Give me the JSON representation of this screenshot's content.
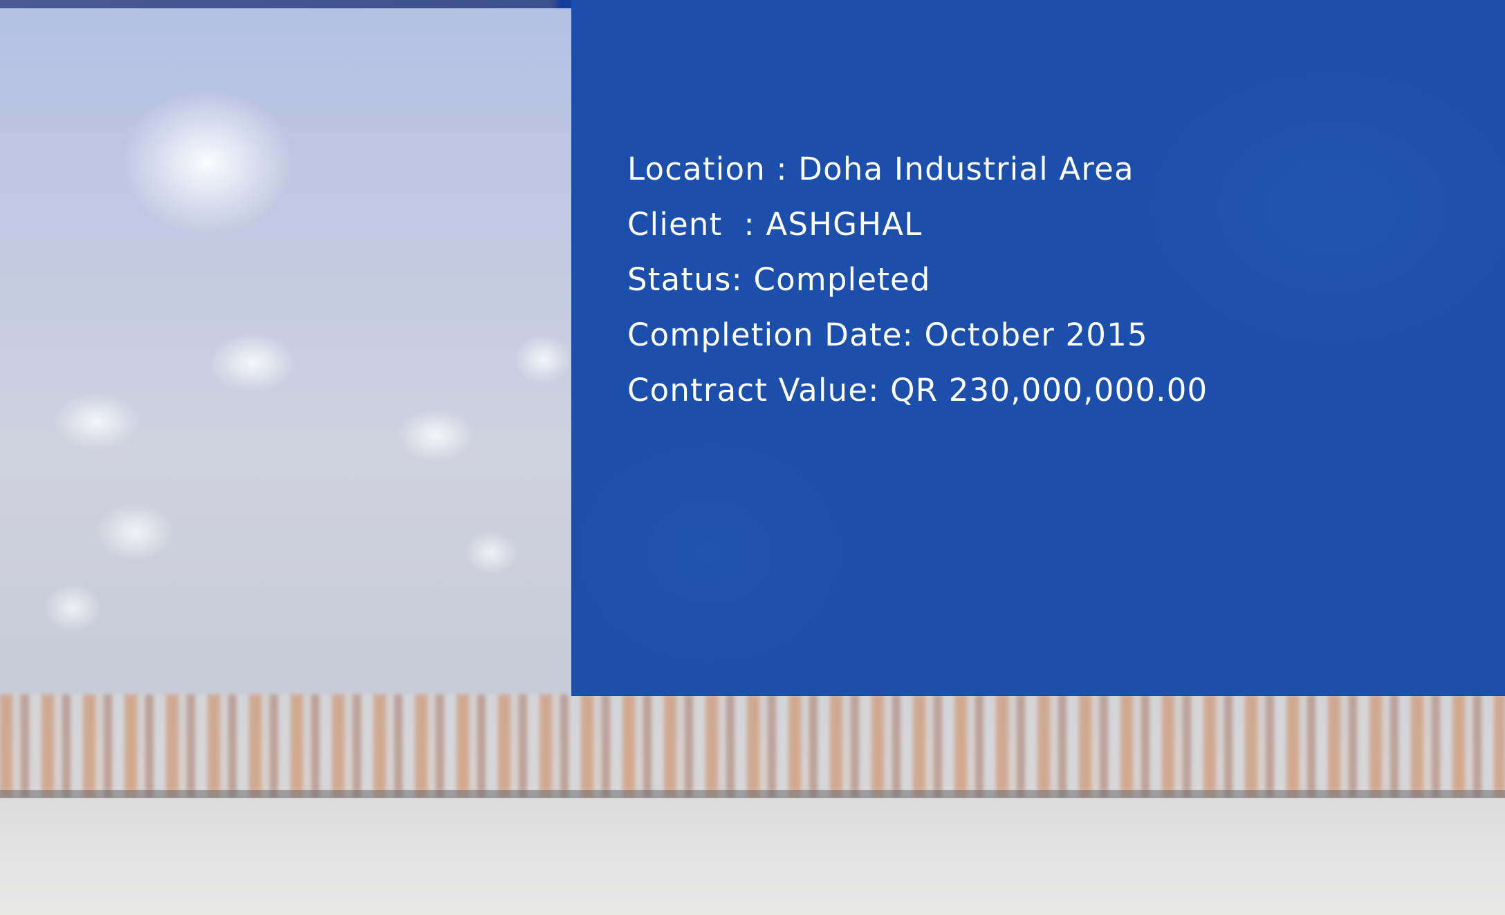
{
  "project_details": {
    "location": "Location : Doha Industrial Area",
    "client": "Client  : ASHGHAL",
    "status": "Status: Completed",
    "completion_date": "Completion Date: October 2015",
    "contract_value": "Contract Value: QR 230,000,000.00"
  },
  "colors": {
    "panel": "#1c4fab",
    "text": "#ffffff"
  }
}
